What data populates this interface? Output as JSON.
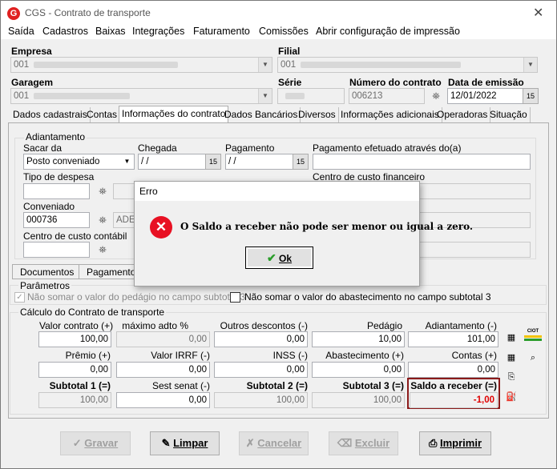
{
  "window": {
    "title": "CGS - Contrato de transporte",
    "logo": "G"
  },
  "menu": [
    "Saída",
    "Cadastros",
    "Baixas",
    "Integrações",
    "Faturamento",
    "Comissões",
    "Abrir configuração de impressão"
  ],
  "header": {
    "empresa_label": "Empresa",
    "empresa_value": "001",
    "filial_label": "Filial",
    "filial_value": "001",
    "garagem_label": "Garagem",
    "garagem_value": "001",
    "serie_label": "Série",
    "numero_label": "Número do contrato",
    "numero_value": "006213",
    "data_label": "Data de emissão",
    "data_value": "12/01/2022"
  },
  "tabs": [
    "Dados cadastrais",
    "Contas",
    "Informações do contrato",
    "Dados Bancários",
    "Diversos",
    "Informações adicionais",
    "Operadoras",
    "Situação"
  ],
  "adiantamento": {
    "group_title": "Adiantamento",
    "sacar_label": "Sacar da",
    "sacar_value": "Posto conveniado",
    "chegada_label": "Chegada",
    "chegada_value": " / /",
    "pagamento_label": "Pagamento",
    "pagamento_value": " / /",
    "pag_efetuado_label": "Pagamento efetuado através do(a)",
    "tipo_despesa_label": "Tipo de despesa",
    "centro_financeiro_label": "Centro de custo financeiro",
    "conveniado_label": "Conveniado",
    "conveniado_value": "000736",
    "conveniado_name": "ADE",
    "centro_contabil_label": "Centro de custo contábil"
  },
  "subtabs": [
    "Documentos",
    "Pagamento F"
  ],
  "parametros": {
    "title": "Parâmetros",
    "opt1": "Não somar o valor do pedágio no campo subtotal 3",
    "opt2": "Não somar o valor do abastecimento no campo subtotal 3"
  },
  "calculo": {
    "title": "Cálculo do Contrato de transporte",
    "row1_labels": [
      "Valor contrato (+)",
      "máximo adto %",
      "Outros descontos (-)",
      "Pedágio",
      "Adiantamento (-)"
    ],
    "row1_values": [
      "100,00",
      "0,00",
      "0,00",
      "10,00",
      "101,00"
    ],
    "row2_labels": [
      "Prêmio (+)",
      "Valor IRRF (-)",
      "INSS (-)",
      "Abastecimento (+)",
      "Contas (+)"
    ],
    "row2_values": [
      "0,00",
      "0,00",
      "0,00",
      "0,00",
      "0,00"
    ],
    "row3_labels": [
      "Subtotal 1 (=)",
      "Sest senat (-)",
      "Subtotal 2 (=)",
      "Subtotal 3 (=)",
      "Saldo a receber (=)"
    ],
    "row3_values": [
      "100,00",
      "0,00",
      "100,00",
      "100,00",
      "-1,00"
    ],
    "ciot_label": "CIOT"
  },
  "buttons": {
    "gravar": "Gravar",
    "limpar": "Limpar",
    "cancelar": "Cancelar",
    "excluir": "Excluir",
    "imprimir": "Imprimir"
  },
  "dialog": {
    "title": "Erro",
    "message": "O Saldo a receber não pode ser menor ou igual a zero.",
    "ok": "Ok"
  },
  "colors": {
    "error_red": "#e81123",
    "highlight_border": "#8b1a1a",
    "negative_value": "#e00000"
  }
}
